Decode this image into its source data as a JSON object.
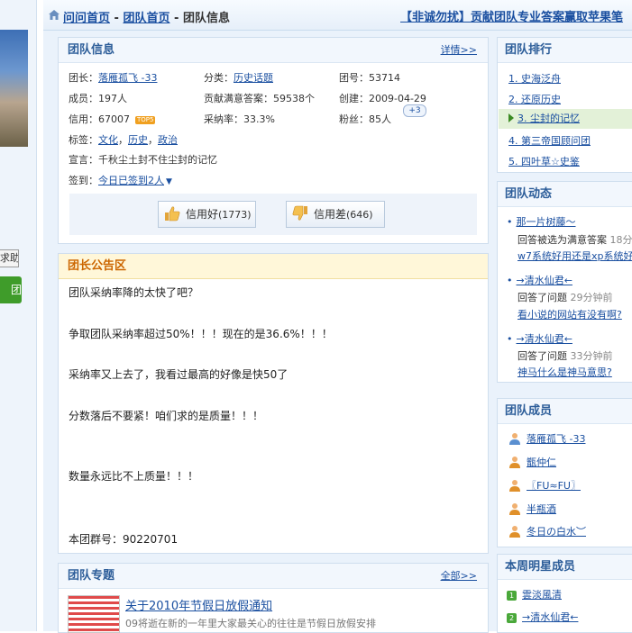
{
  "breadcrumb": {
    "home": "问问首页",
    "sep1": " - ",
    "team_home": "团队首页",
    "sep2": " - ",
    "current": "团队信息",
    "ad": "【非诚勿扰】贡献团队专业答案赢取苹果笔"
  },
  "left": {
    "help_btn": "求助",
    "green_btn": "团"
  },
  "team_info": {
    "title": "团队信息",
    "more": "详情>>",
    "leader_label": "团长：",
    "leader": "落雁孤飞 -33",
    "category_label": "分类：",
    "category": "历史话题",
    "team_no_label": "团号：",
    "team_no": "53714",
    "members_label": "成员：",
    "members": "197人",
    "answers_label": "贡献满意答案：",
    "answers": "59538个",
    "created_label": "创建：",
    "created": "2009-04-29",
    "credit_label": "信用：",
    "credit": "67007",
    "top_badge": "TOP5",
    "adopt_label": "采纳率：",
    "adopt": "33.3%",
    "fans_label": "粉丝：",
    "fans": "85人",
    "fans_plus": "+3",
    "tags_label": "标签：",
    "tags": [
      "文化",
      "历史",
      "政治"
    ],
    "tag_sep": "，",
    "motto_label": "宣言：",
    "motto": "千秋尘土封不住尘封的记忆",
    "checkin_label": "签到：",
    "checkin": "今日已签到2人",
    "good_label": "信用好",
    "good_count": "(1773)",
    "bad_label": "信用差",
    "bad_count": "(646)"
  },
  "announcement": {
    "title": "团长公告区",
    "lines": [
      "团队采纳率降的太快了吧？",
      "争取团队采纳率超过50%！！！现在的是36.6%！！！",
      "采纳率又上去了，我看过最高的好像是快50了",
      "分数落后不要紧！咱们求的是质量！！！",
      "数量永远比不上质量！！！",
      "本团群号：90220701"
    ]
  },
  "topics": {
    "title": "团队专题",
    "more": "全部>>",
    "item_title": "关于2010年节假日放假通知",
    "item_desc": "09将逝在新的一年里大家最关心的往往是节假日放假安排"
  },
  "ranking": {
    "title": "团队排行",
    "items": [
      "1. 史海泛舟",
      "2. 还原历史",
      "3. 尘封的记忆",
      "4. 第三帝国顾问团",
      "5. 四叶草☆史鉴"
    ]
  },
  "dynamics": {
    "title": "团队动态",
    "entries": [
      {
        "user": "那一片树藤〜",
        "action": "回答被选为满意答案",
        "time": "18分钟前",
        "question": "w7系统好用还是xp系统好用"
      },
      {
        "user": "→清水仙君←",
        "action": "回答了问题",
        "time": "29分钟前",
        "question": "看小说的网站有没有啊?"
      },
      {
        "user": "→清水仙君←",
        "action": "回答了问题",
        "time": "33分钟前",
        "question": "神马什么是神马意思?"
      }
    ]
  },
  "members_box": {
    "title": "团队成员",
    "items": [
      "落雁孤飞 -33",
      "甑仲仁",
      "〖FU≈FU〗",
      "半瓶酒",
      "冬日の白水︶"
    ]
  },
  "stars": {
    "title": "本周明星成员",
    "items": [
      {
        "n": "1",
        "name": "雲淡風清"
      },
      {
        "n": "2",
        "name": "→清水仙君←"
      }
    ]
  }
}
